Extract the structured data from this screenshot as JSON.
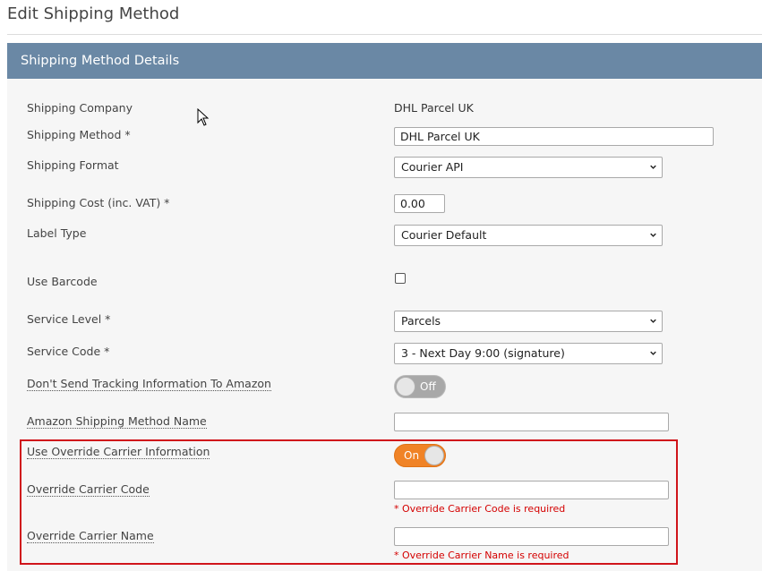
{
  "page": {
    "title": "Edit Shipping Method"
  },
  "panel": {
    "header": "Shipping Method Details"
  },
  "fields": {
    "shipping_company": {
      "label": "Shipping Company",
      "value": "DHL Parcel UK"
    },
    "shipping_method": {
      "label": "Shipping Method *",
      "value": "DHL Parcel UK"
    },
    "shipping_format": {
      "label": "Shipping Format",
      "value": "Courier API"
    },
    "shipping_cost": {
      "label": "Shipping Cost (inc. VAT) *",
      "value": "0.00"
    },
    "label_type": {
      "label": "Label Type",
      "value": "Courier Default"
    },
    "use_barcode": {
      "label": "Use Barcode",
      "checked": false
    },
    "service_level": {
      "label": "Service Level *",
      "value": "Parcels"
    },
    "service_code": {
      "label": "Service Code *",
      "value": "3 - Next Day 9:00 (signature)"
    },
    "dont_send_tracking": {
      "label": "Don't Send Tracking Information To Amazon",
      "state": "Off"
    },
    "amazon_shipping_method_name": {
      "label": "Amazon Shipping Method Name",
      "value": ""
    },
    "use_override_carrier": {
      "label": "Use Override Carrier Information",
      "state": "On"
    },
    "override_carrier_code": {
      "label": "Override Carrier Code",
      "value": "",
      "error": "* Override Carrier Code is required"
    },
    "override_carrier_name": {
      "label": "Override Carrier Name",
      "value": "",
      "error": "* Override Carrier Name is required"
    }
  },
  "colors": {
    "panel_header": "#6a88a5",
    "toggle_on": "#f08326",
    "toggle_off": "#a8a8a8",
    "error": "#d40000",
    "highlight_border": "#d0141b"
  },
  "icons": {
    "select_arrow": "chevron-down-icon",
    "cursor": "mouse-pointer-icon"
  }
}
